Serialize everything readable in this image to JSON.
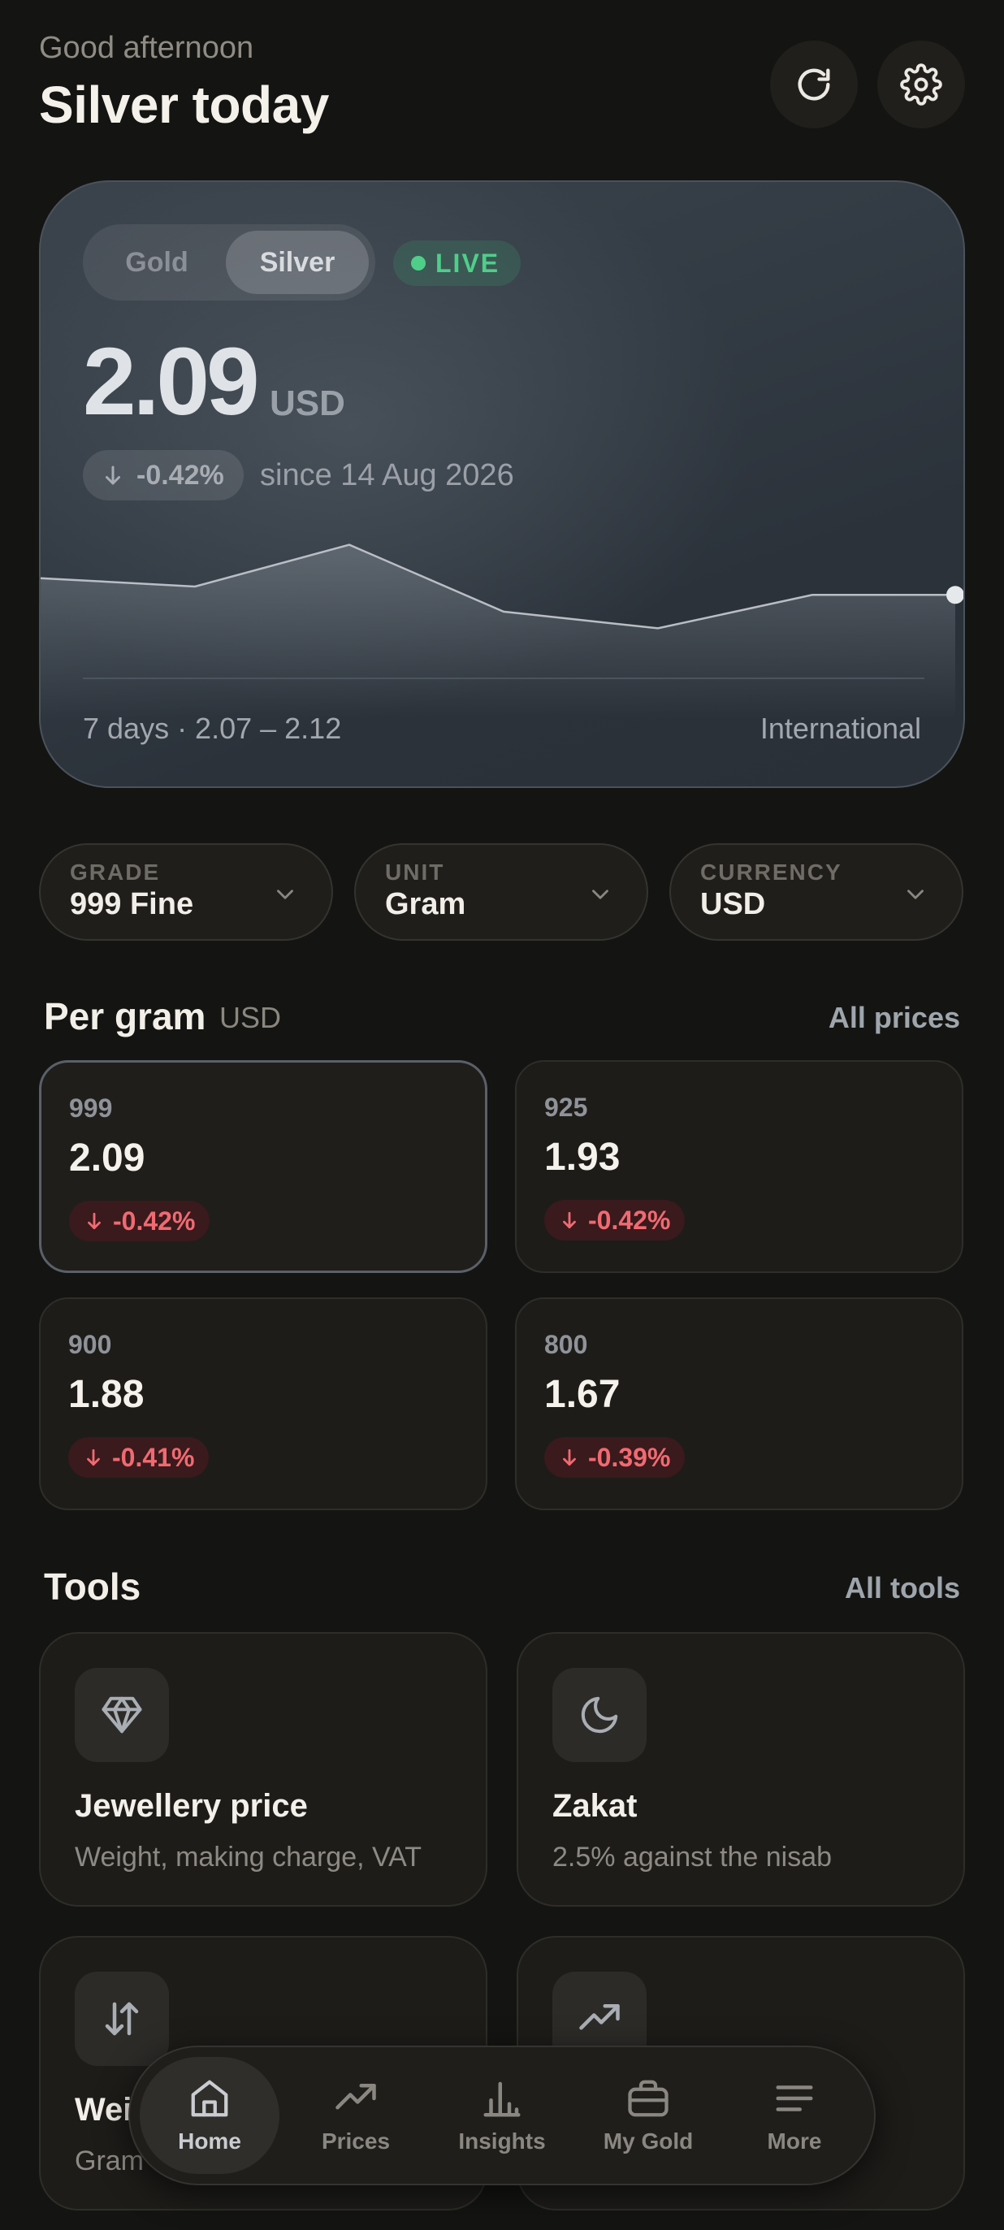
{
  "header": {
    "greeting": "Good afternoon",
    "title": "Silver today",
    "refresh_icon": "refresh-icon",
    "settings_icon": "gear-icon"
  },
  "hero": {
    "tabs": [
      "Gold",
      "Silver"
    ],
    "selected_tab": "Silver",
    "live_label": "LIVE",
    "price": "2.09",
    "currency": "USD",
    "change": "-0.42%",
    "since": "since 14 Aug 2026",
    "range_text": "7 days · 2.07 – 2.12",
    "market": "International",
    "sparkline": [
      2.1,
      2.095,
      2.12,
      2.08,
      2.07,
      2.09,
      2.09
    ]
  },
  "filters": [
    {
      "label": "GRADE",
      "value": "999 Fine"
    },
    {
      "label": "UNIT",
      "value": "Gram"
    },
    {
      "label": "CURRENCY",
      "value": "USD"
    }
  ],
  "per_gram": {
    "title": "Per gram",
    "currency": "USD",
    "link": "All prices",
    "cards": [
      {
        "grade": "999",
        "price": "2.09",
        "change": "-0.42%"
      },
      {
        "grade": "925",
        "price": "1.93",
        "change": "-0.42%"
      },
      {
        "grade": "900",
        "price": "1.88",
        "change": "-0.41%"
      },
      {
        "grade": "800",
        "price": "1.67",
        "change": "-0.39%"
      }
    ]
  },
  "tools": {
    "title": "Tools",
    "link": "All tools",
    "items": [
      {
        "title": "Jewellery price",
        "desc": "Weight, making charge, VAT",
        "icon": "diamond-icon"
      },
      {
        "title": "Zakat",
        "desc": "2.5% against the nisab",
        "icon": "moon-icon"
      },
      {
        "title": "Wei",
        "desc": "Gram",
        "icon": "swap-arrows-icon"
      },
      {
        "title": "",
        "desc": "",
        "icon": "trend-up-icon"
      }
    ]
  },
  "nav": [
    {
      "label": "Home",
      "icon": "home-icon",
      "active": true
    },
    {
      "label": "Prices",
      "icon": "trend-up-icon"
    },
    {
      "label": "Insights",
      "icon": "bar-chart-icon"
    },
    {
      "label": "My Gold",
      "icon": "briefcase-icon"
    },
    {
      "label": "More",
      "icon": "menu-icon"
    }
  ],
  "colors": {
    "accent_live": "#4fce8a",
    "negative": "#f06a72",
    "background": "#141412"
  }
}
